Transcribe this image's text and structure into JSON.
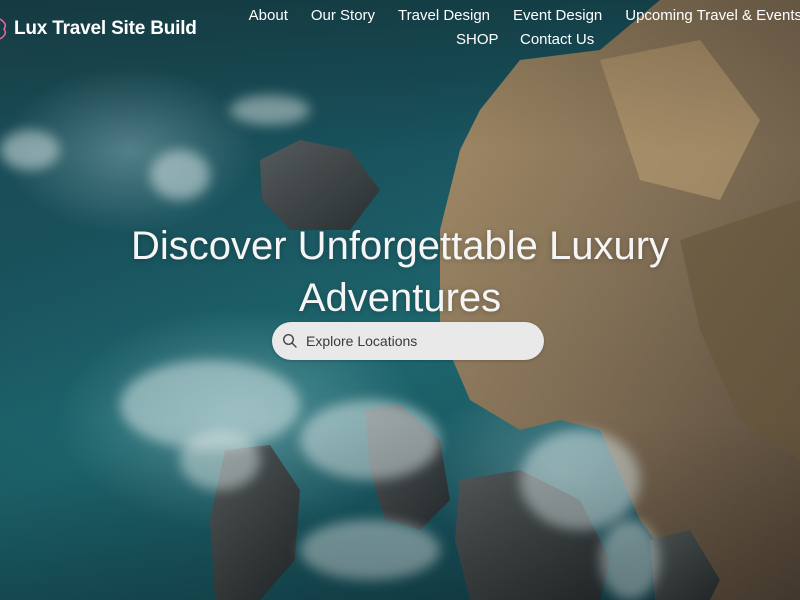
{
  "site": {
    "title": "Lux Travel Site Build"
  },
  "nav": {
    "row1": [
      "About",
      "Our Story",
      "Travel Design",
      "Event Design",
      "Upcoming Travel & Events"
    ],
    "row2": [
      "SHOP",
      "Contact Us"
    ]
  },
  "hero": {
    "headline_line1": "Discover Unforgettable Luxury",
    "headline_line2": "Adventures",
    "search_placeholder": "Explore Locations",
    "search_icon": "search-icon",
    "background": "aerial-coastal-rocks-ocean"
  },
  "colors": {
    "text": "#ffffff",
    "search_bg": "#e9e9ea",
    "logo_accent": "#e2679b"
  }
}
